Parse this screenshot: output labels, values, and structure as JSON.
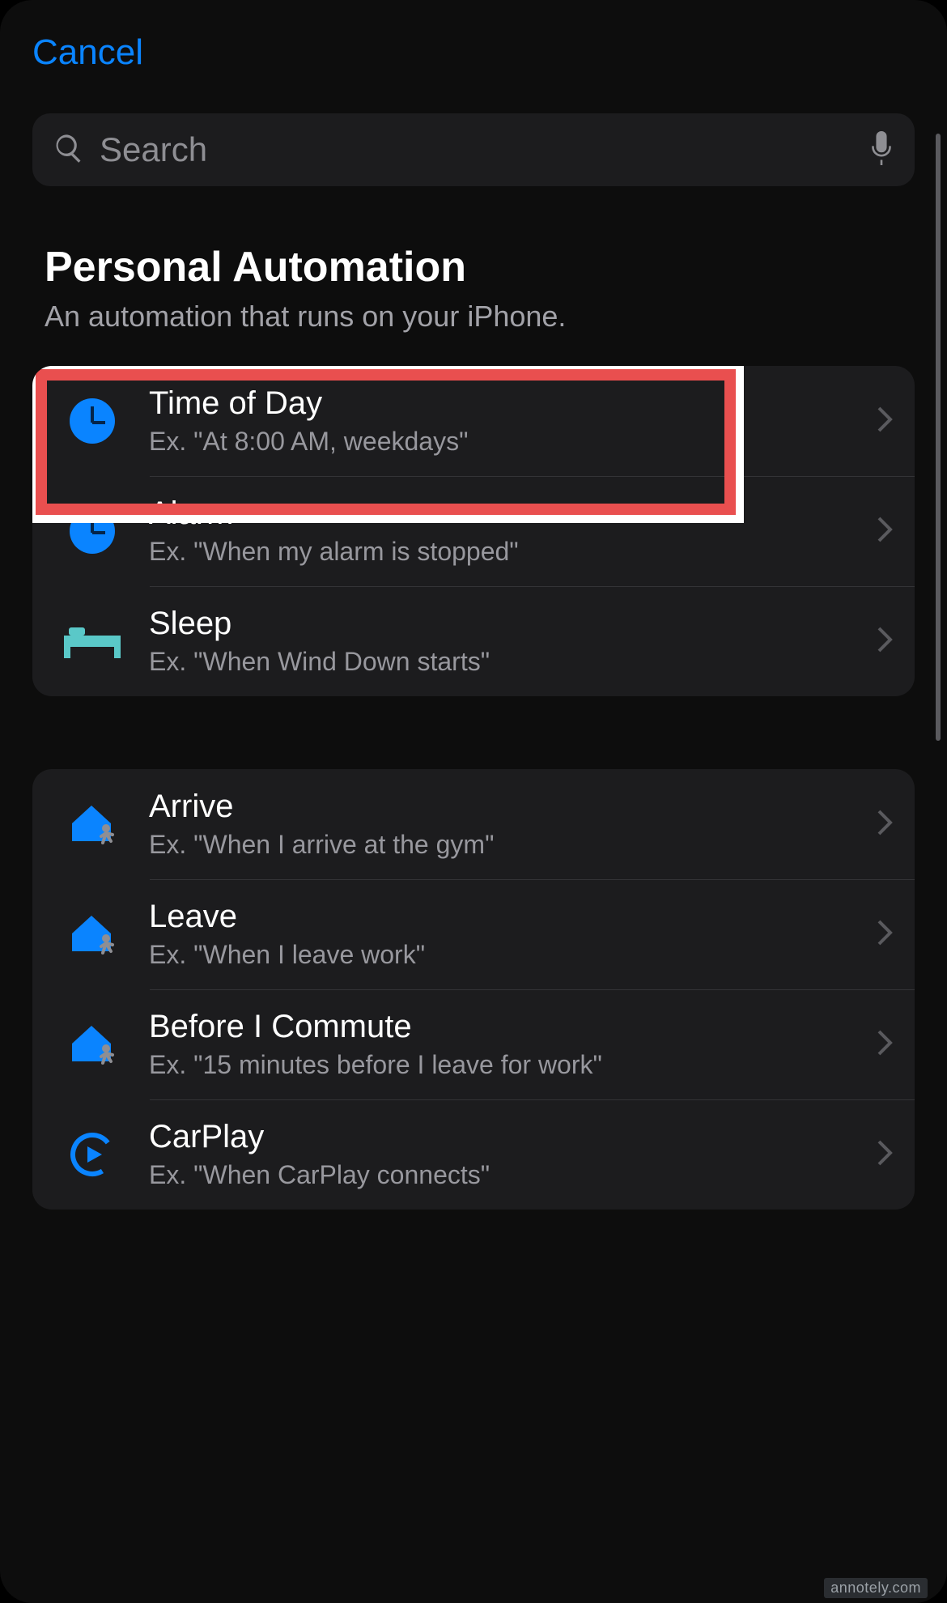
{
  "nav": {
    "cancel": "Cancel"
  },
  "search": {
    "placeholder": "Search"
  },
  "header": {
    "title": "Personal Automation",
    "subtitle": "An automation that runs on your iPhone."
  },
  "groups": [
    {
      "rows": [
        {
          "icon": "clock-icon",
          "title": "Time of Day",
          "sub": "Ex. \"At 8:00 AM, weekdays\"",
          "highlighted": true
        },
        {
          "icon": "clock-icon",
          "title": "Alarm",
          "sub": "Ex. \"When my alarm is stopped\""
        },
        {
          "icon": "bed-icon",
          "title": "Sleep",
          "sub": "Ex. \"When Wind Down starts\""
        }
      ]
    },
    {
      "rows": [
        {
          "icon": "home-walk-icon",
          "title": "Arrive",
          "sub": "Ex. \"When I arrive at the gym\""
        },
        {
          "icon": "home-walk-icon",
          "title": "Leave",
          "sub": "Ex. \"When I leave work\""
        },
        {
          "icon": "home-walk-icon",
          "title": "Before I Commute",
          "sub": "Ex. \"15 minutes before I leave for work\""
        },
        {
          "icon": "carplay-icon",
          "title": "CarPlay",
          "sub": "Ex. \"When CarPlay connects\""
        }
      ]
    }
  ],
  "watermark": "annotely.com",
  "colors": {
    "accent": "#0a84ff",
    "teal": "#5ac8c8",
    "highlight_border_outer": "#ffffff",
    "highlight_border_inner": "#e94f4f"
  }
}
